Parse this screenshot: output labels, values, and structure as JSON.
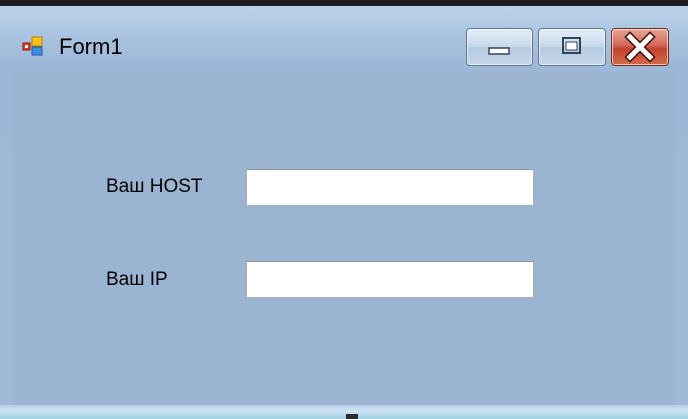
{
  "window": {
    "title": "Form1",
    "icon": "winforms-app-icon",
    "controls": {
      "minimize_icon": "minimize-icon",
      "maximize_icon": "maximize-icon",
      "close_icon": "close-icon"
    }
  },
  "form": {
    "host_label": "Ваш HOST",
    "host_value": "",
    "ip_label": "Ваш IP",
    "ip_value": ""
  },
  "colors": {
    "client_background": "#9ab4d2",
    "close_button": "#c0442c"
  }
}
